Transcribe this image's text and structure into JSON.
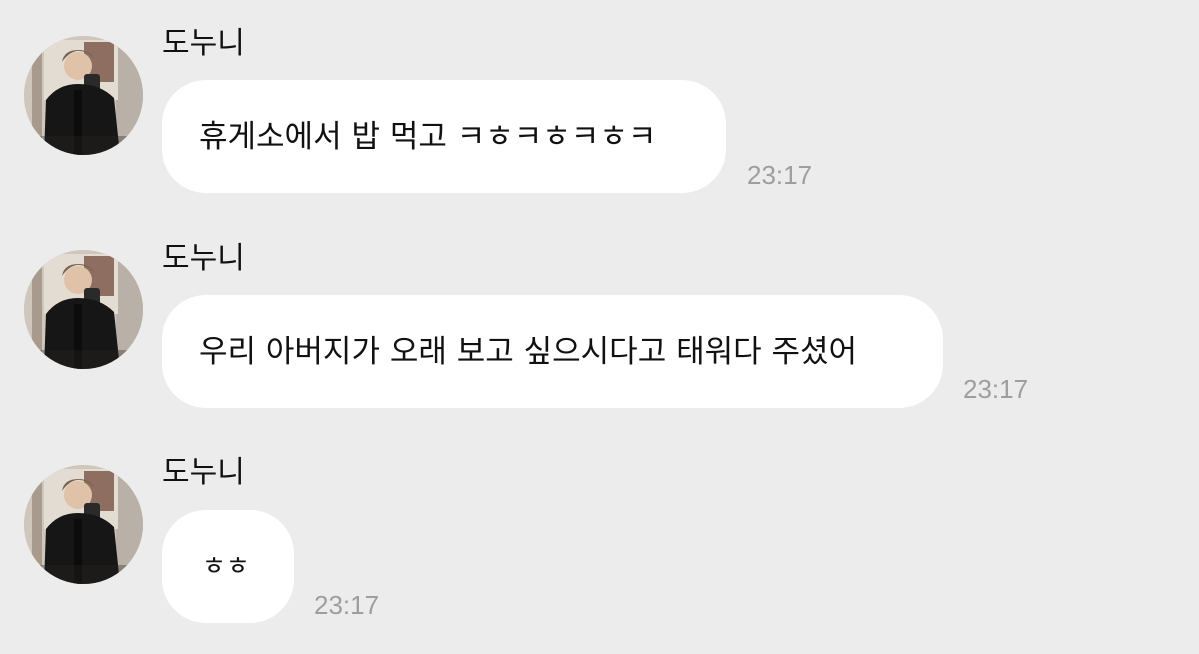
{
  "chat": {
    "messages": [
      {
        "sender": "도누니",
        "text": "휴게소에서 밥 먹고 ㅋㅎㅋㅎㅋㅎㅋ",
        "time": "23:17",
        "avatar_icon": "profile-photo"
      },
      {
        "sender": "도누니",
        "text": "우리 아버지가 오래 보고 싶으시다고 태워다 주셨어",
        "time": "23:17",
        "avatar_icon": "profile-photo"
      },
      {
        "sender": "도누니",
        "text": "ㅎㅎ",
        "time": "23:17",
        "avatar_icon": "profile-photo"
      }
    ]
  },
  "colors": {
    "background": "#ececec",
    "bubble": "#ffffff",
    "timestamp": "#9e9e9e",
    "text": "#111111"
  }
}
